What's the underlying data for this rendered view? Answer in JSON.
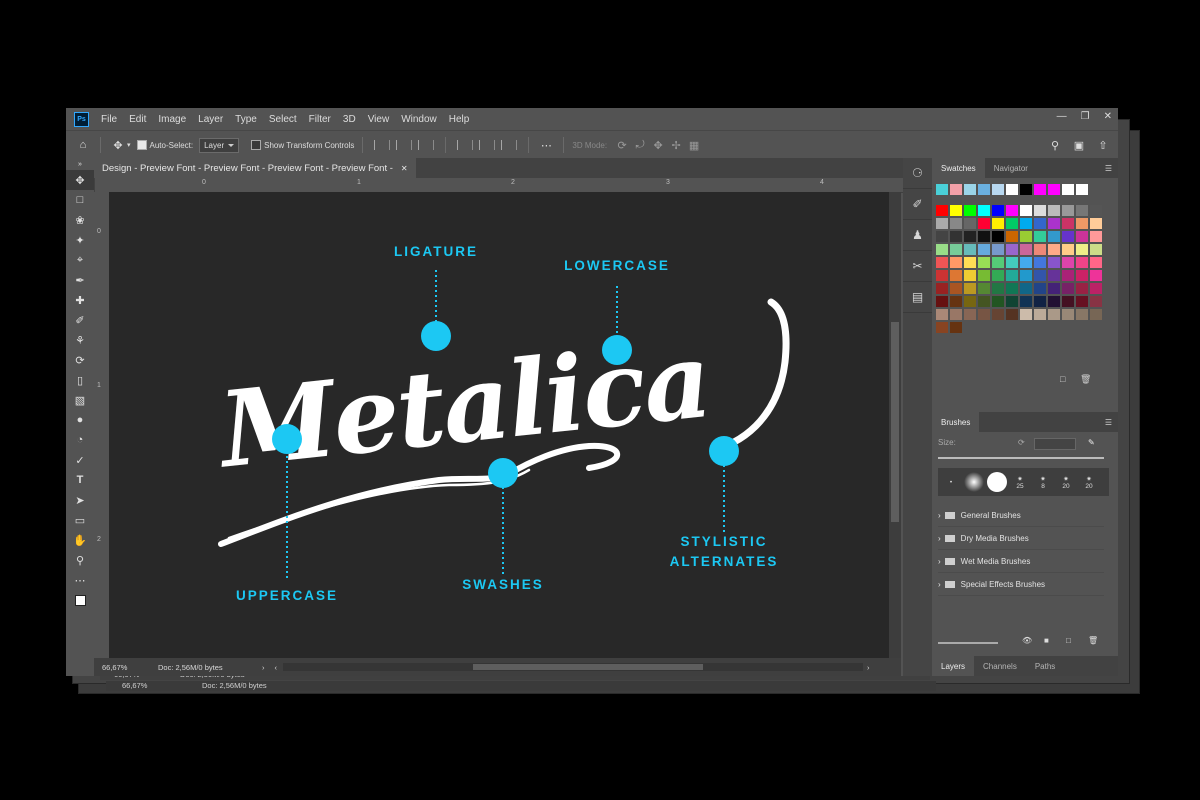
{
  "app": {
    "logo": "Ps",
    "menu": [
      "File",
      "Edit",
      "Image",
      "Layer",
      "Type",
      "Select",
      "Filter",
      "3D",
      "View",
      "Window",
      "Help"
    ]
  },
  "options_bar": {
    "auto_select_label": "Auto-Select:",
    "auto_select_value": "Layer",
    "show_transform_label": "Show Transform Controls",
    "three_d_mode_label": "3D Mode:"
  },
  "document": {
    "tab_title": "Design - Preview Font - Preview Font - Preview Font - Preview Font -",
    "zoom": "66,67%",
    "doc_info": "Doc: 2,56M/0 bytes",
    "ruler_marks": [
      "0",
      "1",
      "2",
      "3",
      "4"
    ],
    "vruler_marks": [
      "0",
      "1",
      "2"
    ]
  },
  "artwork": {
    "word": "Metalica",
    "callouts": {
      "ligature": "LIGATURE",
      "lowercase": "LOWERCASE",
      "uppercase": "UPPERCASE",
      "swashes": "SWASHES",
      "stylistic_line1": "STYLISTIC",
      "stylistic_line2": "ALTERNATES"
    },
    "accent_color": "#1cc8f3"
  },
  "panels": {
    "swatches_tab": "Swatches",
    "navigator_tab": "Navigator",
    "brushes_tab": "Brushes",
    "size_label": "Size:",
    "brush_sizes": [
      "25",
      "8",
      "20",
      "20"
    ],
    "brush_folders": [
      "General Brushes",
      "Dry Media Brushes",
      "Wet Media Brushes",
      "Special Effects Brushes"
    ],
    "layers_tabs": [
      "Layers",
      "Channels",
      "Paths"
    ]
  },
  "icons": {
    "home": "home-icon",
    "move": "move-icon",
    "search": "search-icon",
    "workspace": "workspace-icon",
    "share": "share-icon"
  }
}
